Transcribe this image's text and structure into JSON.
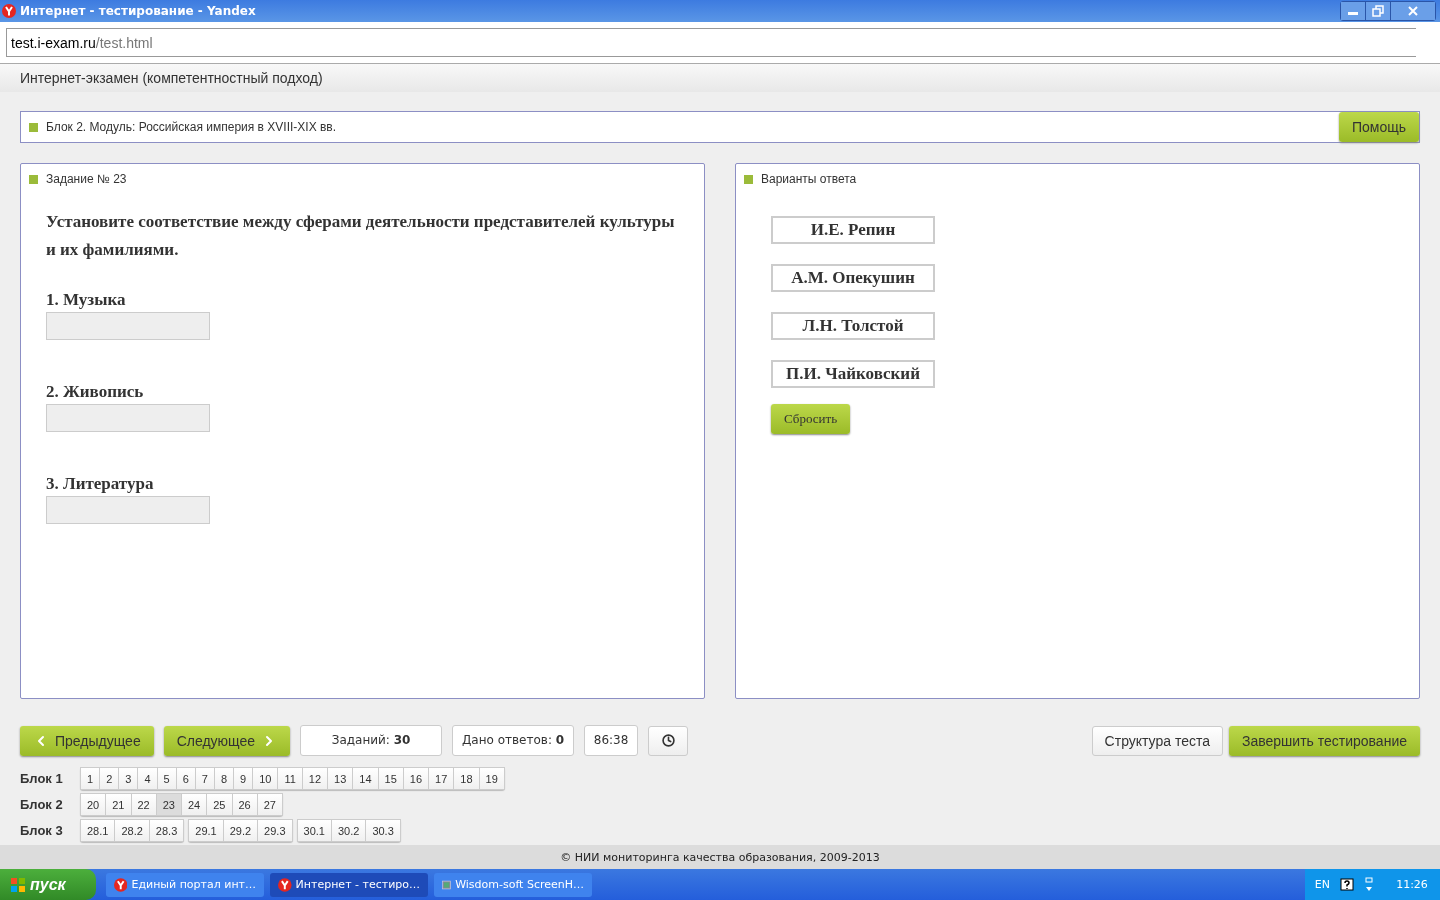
{
  "window": {
    "title": "Интернет - тестирование - Yandex"
  },
  "address": {
    "domain": "test.i-exam.ru",
    "path": "/test.html"
  },
  "app_header": "Интернет-экзамен (компетентностный подход)",
  "block_bar": {
    "title": "Блок 2. Модуль: Российская империя в XVIII-XIX вв.",
    "help_button": "Помощь"
  },
  "task": {
    "heading": "Задание № 23",
    "question": "Установите соответствие между сферами деятельности представителей культуры и их фамилиями.",
    "items": [
      {
        "label": "1. Музыка"
      },
      {
        "label": "2. Живопись"
      },
      {
        "label": "3. Литература"
      }
    ]
  },
  "answers": {
    "heading": "Варианты ответа",
    "options": [
      "И.Е. Репин",
      "А.М. Опекушин",
      "Л.Н. Толстой",
      "П.И. Чайковский"
    ],
    "reset_button": "Сбросить"
  },
  "toolbar": {
    "prev_button": "Предыдущее",
    "next_button": "Следующее",
    "tasks_counter": "Заданий: **30**",
    "answers_counter": "Дано ответов: **0**",
    "timer": "86:38",
    "structure_button": "Структура теста",
    "finish_button": "Завершить тестирование"
  },
  "blocks": [
    {
      "label": "Блок 1",
      "groups": [
        [
          {
            "label": "1",
            "selected": false
          },
          {
            "label": "2",
            "selected": false
          },
          {
            "label": "3",
            "selected": false
          },
          {
            "label": "4",
            "selected": false
          },
          {
            "label": "5",
            "selected": false
          },
          {
            "label": "6",
            "selected": false
          },
          {
            "label": "7",
            "selected": false
          },
          {
            "label": "8",
            "selected": false
          },
          {
            "label": "9",
            "selected": false
          },
          {
            "label": "10",
            "selected": false
          },
          {
            "label": "11",
            "selected": false
          },
          {
            "label": "12",
            "selected": false
          },
          {
            "label": "13",
            "selected": false
          },
          {
            "label": "14",
            "selected": false
          },
          {
            "label": "15",
            "selected": false
          },
          {
            "label": "16",
            "selected": false
          },
          {
            "label": "17",
            "selected": false
          },
          {
            "label": "18",
            "selected": false
          },
          {
            "label": "19",
            "selected": false
          }
        ]
      ]
    },
    {
      "label": "Блок 2",
      "groups": [
        [
          {
            "label": "20",
            "selected": false
          },
          {
            "label": "21",
            "selected": false
          },
          {
            "label": "22",
            "selected": false
          },
          {
            "label": "23",
            "selected": true
          },
          {
            "label": "24",
            "selected": false
          },
          {
            "label": "25",
            "selected": false
          },
          {
            "label": "26",
            "selected": false
          },
          {
            "label": "27",
            "selected": false
          }
        ]
      ]
    },
    {
      "label": "Блок 3",
      "groups": [
        [
          {
            "label": "28.1",
            "selected": false
          },
          {
            "label": "28.2",
            "selected": false
          },
          {
            "label": "28.3",
            "selected": false
          }
        ],
        [
          {
            "label": "29.1",
            "selected": false
          },
          {
            "label": "29.2",
            "selected": false
          },
          {
            "label": "29.3",
            "selected": false
          }
        ],
        [
          {
            "label": "30.1",
            "selected": false
          },
          {
            "label": "30.2",
            "selected": false
          },
          {
            "label": "30.3",
            "selected": false
          }
        ]
      ]
    }
  ],
  "footer": "© НИИ мониторинга качества образования, 2009-2013",
  "taskbar": {
    "start": "пуск",
    "tasks": [
      {
        "label": "Единый портал инт…",
        "kind": "browser",
        "selected": false
      },
      {
        "label": "Интернет - тестиро…",
        "kind": "browser",
        "selected": true
      },
      {
        "label": "Wisdom-soft ScreenH…",
        "kind": "app",
        "selected": false
      }
    ],
    "lang": "EN",
    "clock": "11:26"
  }
}
